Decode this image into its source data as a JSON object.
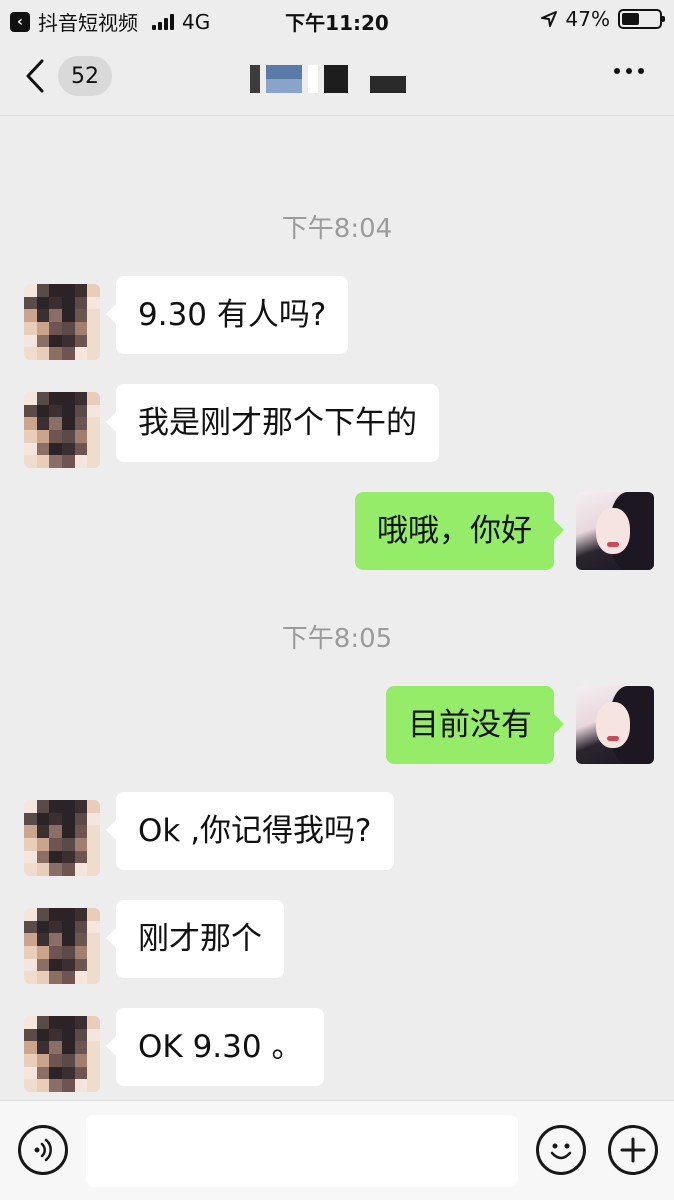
{
  "status_bar": {
    "back_app": "抖音短视频",
    "network": "4G",
    "time": "下午11:20",
    "battery_percent": "47%",
    "battery_level": 0.47
  },
  "nav": {
    "unread_count": "52",
    "more_icon": "more-dots-icon"
  },
  "chat": {
    "timestamps": [
      "下午8:04",
      "下午8:05"
    ],
    "messages": [
      {
        "side": "in",
        "text": "9.30 有人吗?"
      },
      {
        "side": "in",
        "text": "我是刚才那个下午的"
      },
      {
        "side": "out",
        "text": "哦哦，你好"
      },
      {
        "side": "out",
        "text": "目前没有"
      },
      {
        "side": "in",
        "text": "Ok ,你记得我吗?"
      },
      {
        "side": "in",
        "text": "刚才那个"
      },
      {
        "side": "in",
        "text": "OK 9.30 。"
      }
    ]
  },
  "input_bar": {
    "voice_icon": "voice-icon",
    "emoji_icon": "emoji-icon",
    "plus_icon": "plus-icon",
    "text_value": ""
  },
  "colors": {
    "background": "#ededed",
    "incoming_bubble": "#ffffff",
    "outgoing_bubble": "#95ec69",
    "timestamp": "#9b9b9b"
  }
}
